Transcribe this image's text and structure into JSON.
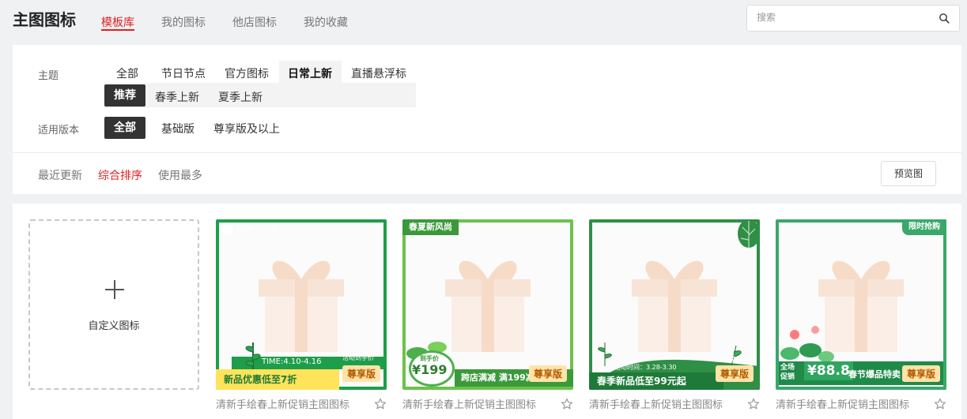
{
  "header": {
    "title": "主图图标",
    "tabs": [
      {
        "label": "模板库",
        "active": true
      },
      {
        "label": "我的图标"
      },
      {
        "label": "他店图标"
      },
      {
        "label": "我的收藏"
      }
    ],
    "search": {
      "placeholder": "搜索",
      "value": ""
    }
  },
  "filters": {
    "theme": {
      "label": "主题",
      "options": [
        "全部",
        "节日节点",
        "官方图标",
        "日常上新",
        "直播悬浮标"
      ],
      "selected": "日常上新",
      "sub_options": [
        "推荐",
        "春季上新",
        "夏季上新"
      ],
      "sub_selected": "推荐"
    },
    "version": {
      "label": "适用版本",
      "options": [
        "全部",
        "基础版",
        "尊享版及以上"
      ],
      "selected": "全部"
    }
  },
  "sort": {
    "options": [
      "最近更新",
      "综合排序",
      "使用最多"
    ],
    "selected": "综合排序",
    "preview_label": "预览图"
  },
  "gallery": {
    "custom_label": "自定义图标",
    "templates": [
      {
        "caption": "清新手绘春上新促销主图图标",
        "tier": "尊享版",
        "corner": "YOUR LOGO",
        "corner_logo": "店铺LOGO",
        "time": "TIME:4.10-4.16",
        "tag": "活动到手价",
        "promo": "新品优惠低至7折",
        "border": "#1e9e4a"
      },
      {
        "caption": "清新手绘春上新促销主图图标",
        "tier": "尊享版",
        "corner": "春夏新风尚",
        "price_label": "到手价",
        "price": "¥199",
        "promo": "跨店满减 满199减",
        "border": "#6cc24a"
      },
      {
        "caption": "清新手绘春上新促销主图图标",
        "tier": "尊享版",
        "time": "活动时间：3.28-3.30",
        "tag": "上新价：",
        "promo": "春季新品低至99元起",
        "border": "#2f8f45"
      },
      {
        "caption": "清新手绘春上新促销主图图标",
        "tier": "尊享版",
        "corner": "限时抢购",
        "left_tag": "全场促销",
        "price": "¥88.8",
        "promo": "春节爆品特卖",
        "border": "#3aa86b"
      }
    ]
  },
  "colors": {
    "accent": "#e02020",
    "dark_pill": "#333333"
  }
}
